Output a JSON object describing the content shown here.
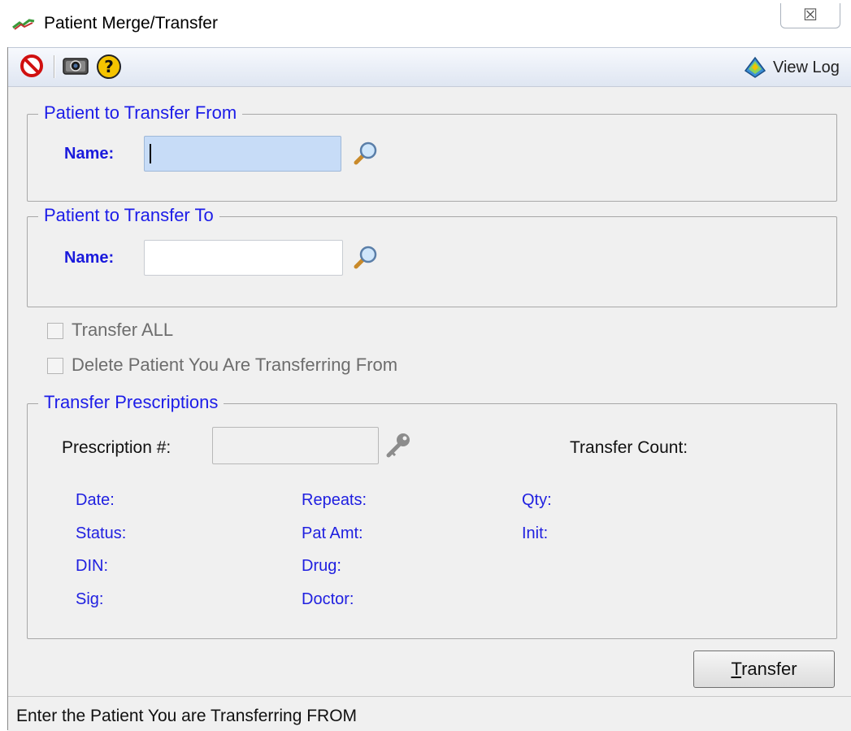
{
  "window": {
    "title": "Patient Merge/Transfer",
    "close_glyph": "☒"
  },
  "toolbar": {
    "icons": [
      "stop-icon",
      "camera-icon",
      "help-icon"
    ],
    "view_log_label": "View Log"
  },
  "from_group": {
    "title": "Patient to Transfer From",
    "name_label": "Name:",
    "name_value": ""
  },
  "to_group": {
    "title": "Patient to Transfer To",
    "name_label": "Name:",
    "name_value": ""
  },
  "options": {
    "transfer_all_label": "Transfer ALL",
    "transfer_all_checked": false,
    "delete_patient_label": "Delete Patient You Are Transferring From",
    "delete_patient_checked": false
  },
  "prescriptions": {
    "title": "Transfer Prescriptions",
    "rx_label": "Prescription #:",
    "rx_value": "",
    "transfer_count_label": "Transfer Count:",
    "fields": {
      "date": "Date:",
      "repeats": "Repeats:",
      "qty": "Qty:",
      "status": "Status:",
      "pat_amt": "Pat Amt:",
      "init": "Init:",
      "din": "DIN:",
      "drug": "Drug:",
      "sig": "Sig:",
      "doctor": "Doctor:"
    }
  },
  "transfer_button": {
    "label_mnemonic": "T",
    "label_rest": "ransfer"
  },
  "status_bar": {
    "text": "Enter the Patient You are Transferring FROM"
  },
  "colors": {
    "group_title": "#1c1ce8",
    "field_label": "#2020e0",
    "focus_fill": "#c7dcf7"
  }
}
